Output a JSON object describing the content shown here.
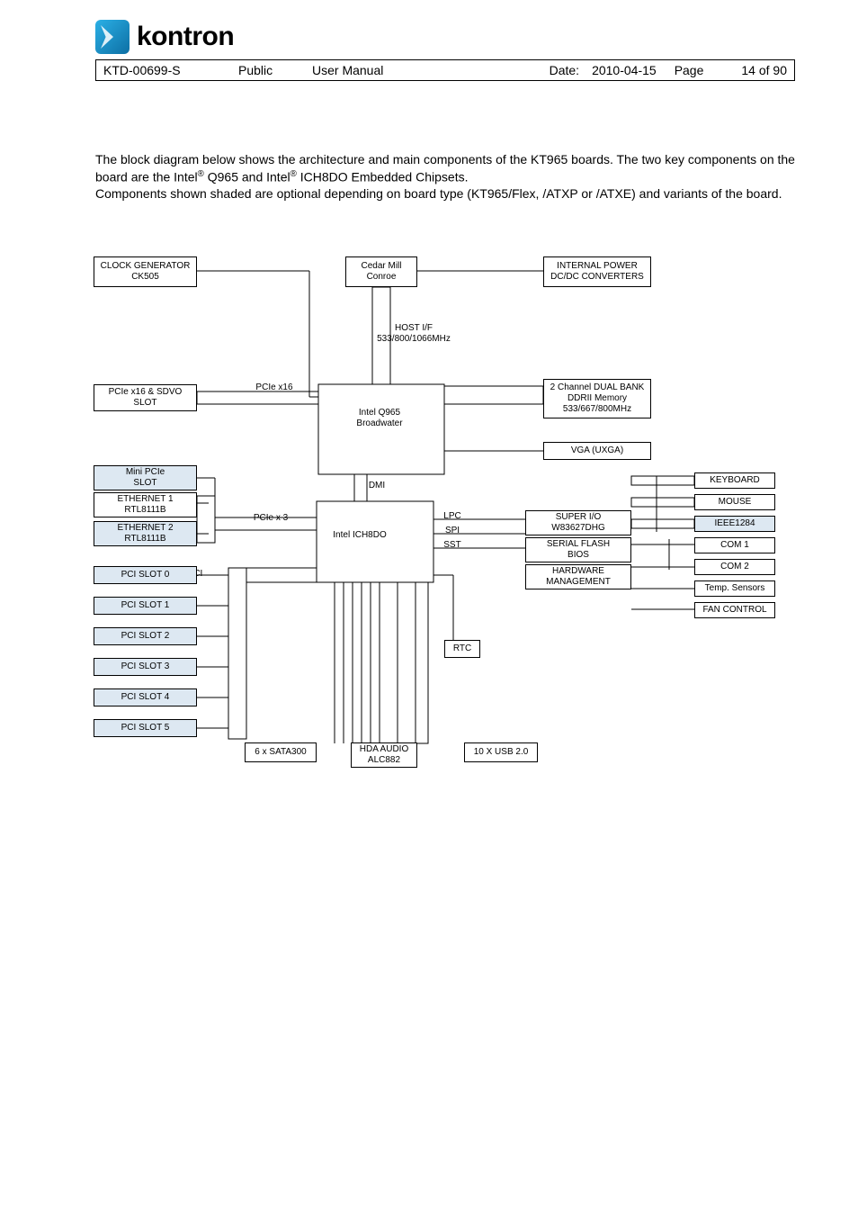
{
  "brand": "kontron",
  "header": {
    "doc_id": "KTD-00699-S",
    "classification": "Public",
    "doc_type": "User Manual",
    "date_label": "Date:",
    "date_value": "2010-04-15",
    "page_label": "Page",
    "page_value": "14 of 90"
  },
  "intro": {
    "line1a": "The block diagram below shows the architecture and main components of the KT965 boards. The two key components on the board are the Intel",
    "sup1": "®",
    "line1b": " Q965 and Intel",
    "sup2": "®",
    "line1c": " ICH8DO Embedded Chipsets.",
    "line2": "Components shown shaded are optional depending on board type (KT965/Flex, /ATXP or /ATXE) and variants of the board."
  },
  "diagram": {
    "clock_gen": "CLOCK GENERATOR\nCK505",
    "cpu": "Cedar Mill\nConroe",
    "int_power": "INTERNAL POWER\nDC/DC CONVERTERS",
    "hostif": "HOST I/F\n533/800/1066MHz",
    "pcie_x16_slot": "PCIe x16 & SDVO\nSLOT",
    "pcie_x16_label": "PCIe x16",
    "q965": "Intel Q965\nBroadwater",
    "ddr": "2 Channel DUAL BANK\nDDRII Memory\n533/667/800MHz",
    "vga": "VGA (UXGA)",
    "mini_pcie": "Mini PCIe\nSLOT",
    "pcie_x3_label": "PCIe x 3",
    "eth1": "ETHERNET 1\nRTL8111B",
    "eth2": "ETHERNET 2\nRTL8111B",
    "ich8do": "Intel ICH8DO",
    "dmi": "DMI",
    "lpc": "LPC",
    "spi": "SPI",
    "sst": "SST",
    "superio": "SUPER I/O\nW83627DHG",
    "serial_flash": "SERIAL FLASH\nBIOS",
    "hw_mgmt": "HARDWARE\nMANAGEMENT",
    "keyboard": "KEYBOARD",
    "mouse": "MOUSE",
    "ieee1284": "IEEE1284",
    "com1": "COM 1",
    "com2": "COM 2",
    "temp": "Temp. Sensors",
    "fan": "FAN CONTROL",
    "pci_label": "PCI",
    "pci_slots": [
      "PCI SLOT 0",
      "PCI SLOT 1",
      "PCI SLOT 2",
      "PCI SLOT 3",
      "PCI SLOT 4",
      "PCI SLOT 5"
    ],
    "sata": "6 x SATA300",
    "hda": "HDA AUDIO\nALC882",
    "usb": "10 X USB 2.0",
    "rtc": "RTC"
  }
}
